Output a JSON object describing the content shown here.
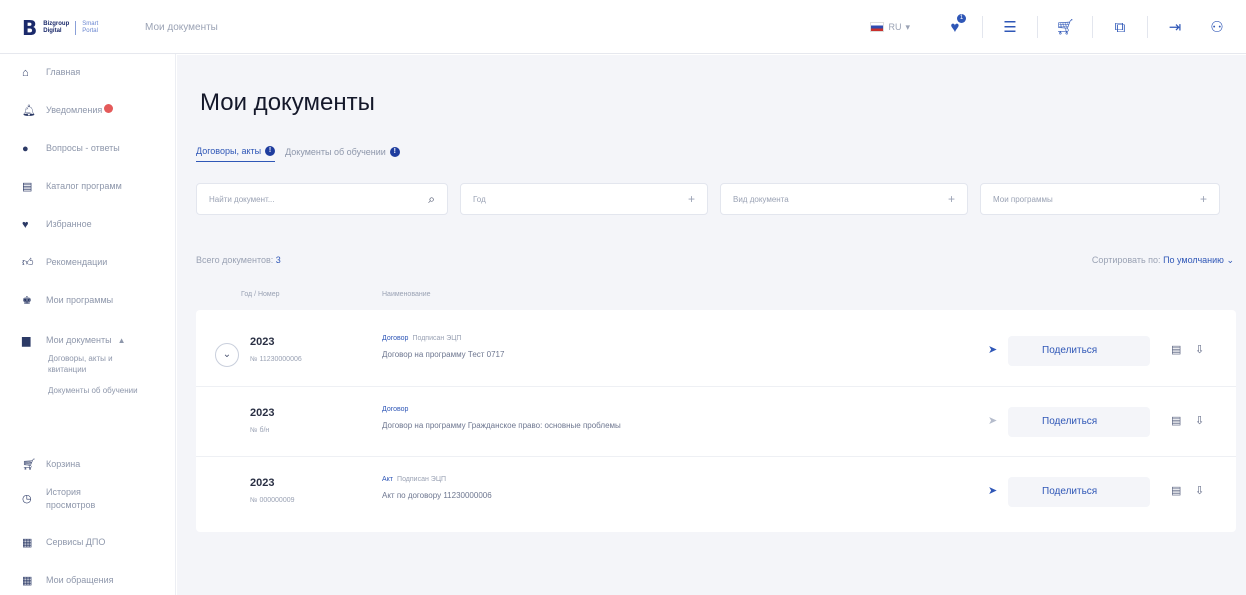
{
  "header": {
    "logo_mark": "B",
    "logo_line1": "Bizgroup",
    "logo_line2": "Digital",
    "logo_tag1": "Smart",
    "logo_tag2": "Portal",
    "breadcrumb": "Мои документы",
    "language": "RU",
    "notifications_count": "1"
  },
  "sidebar": {
    "items": [
      {
        "label": "Главная"
      },
      {
        "label": "Уведомления"
      },
      {
        "label": "Вопросы - ответы"
      },
      {
        "label": "Каталог программ"
      },
      {
        "label": "Избранное"
      },
      {
        "label": "Рекомендации"
      },
      {
        "label": "Мои программы"
      },
      {
        "label": "Мои документы"
      },
      {
        "label": "Корзина"
      },
      {
        "label": "История просмотров"
      },
      {
        "label": "Сервисы ДПО"
      },
      {
        "label": "Мои обращения"
      }
    ],
    "sub_items": [
      {
        "label": "Договоры, акты и квитанции"
      },
      {
        "label": "Документы об обучении"
      }
    ]
  },
  "main": {
    "title": "Мои документы",
    "tabs": [
      {
        "label": "Договоры, акты",
        "badge": "!"
      },
      {
        "label": "Документы об обучении",
        "badge": "!"
      }
    ],
    "filters": {
      "search_placeholder": "Найти документ...",
      "year": "Год",
      "doc_type": "Вид документа",
      "programs": "Мои программы"
    },
    "total_label": "Всего документов:",
    "total_count": "3",
    "sort_label": "Сортировать по:",
    "sort_value": "По умолчанию",
    "columns": {
      "year_number": "Год / Номер",
      "name": "Наименование"
    },
    "rows": [
      {
        "year": "2023",
        "number": "№ 11230000006",
        "type": "Договор",
        "signed": "Подписан ЭЦП",
        "name": "Договор на программу Тест 0717",
        "share": "Поделиться"
      },
      {
        "year": "2023",
        "number": "№ б/н",
        "type": "Договор",
        "signed": "",
        "name": "Договор на программу Гражданское право: основные проблемы",
        "share": "Поделиться"
      },
      {
        "year": "2023",
        "number": "№ 000000009",
        "type": "Акт",
        "signed": "Подписан ЭЦП",
        "name": "Акт по договору 11230000006",
        "share": "Поделиться"
      }
    ]
  },
  "colors": {
    "accent": "#2f57b7",
    "background": "#f4f5f9",
    "badge": "#e45a5a"
  }
}
